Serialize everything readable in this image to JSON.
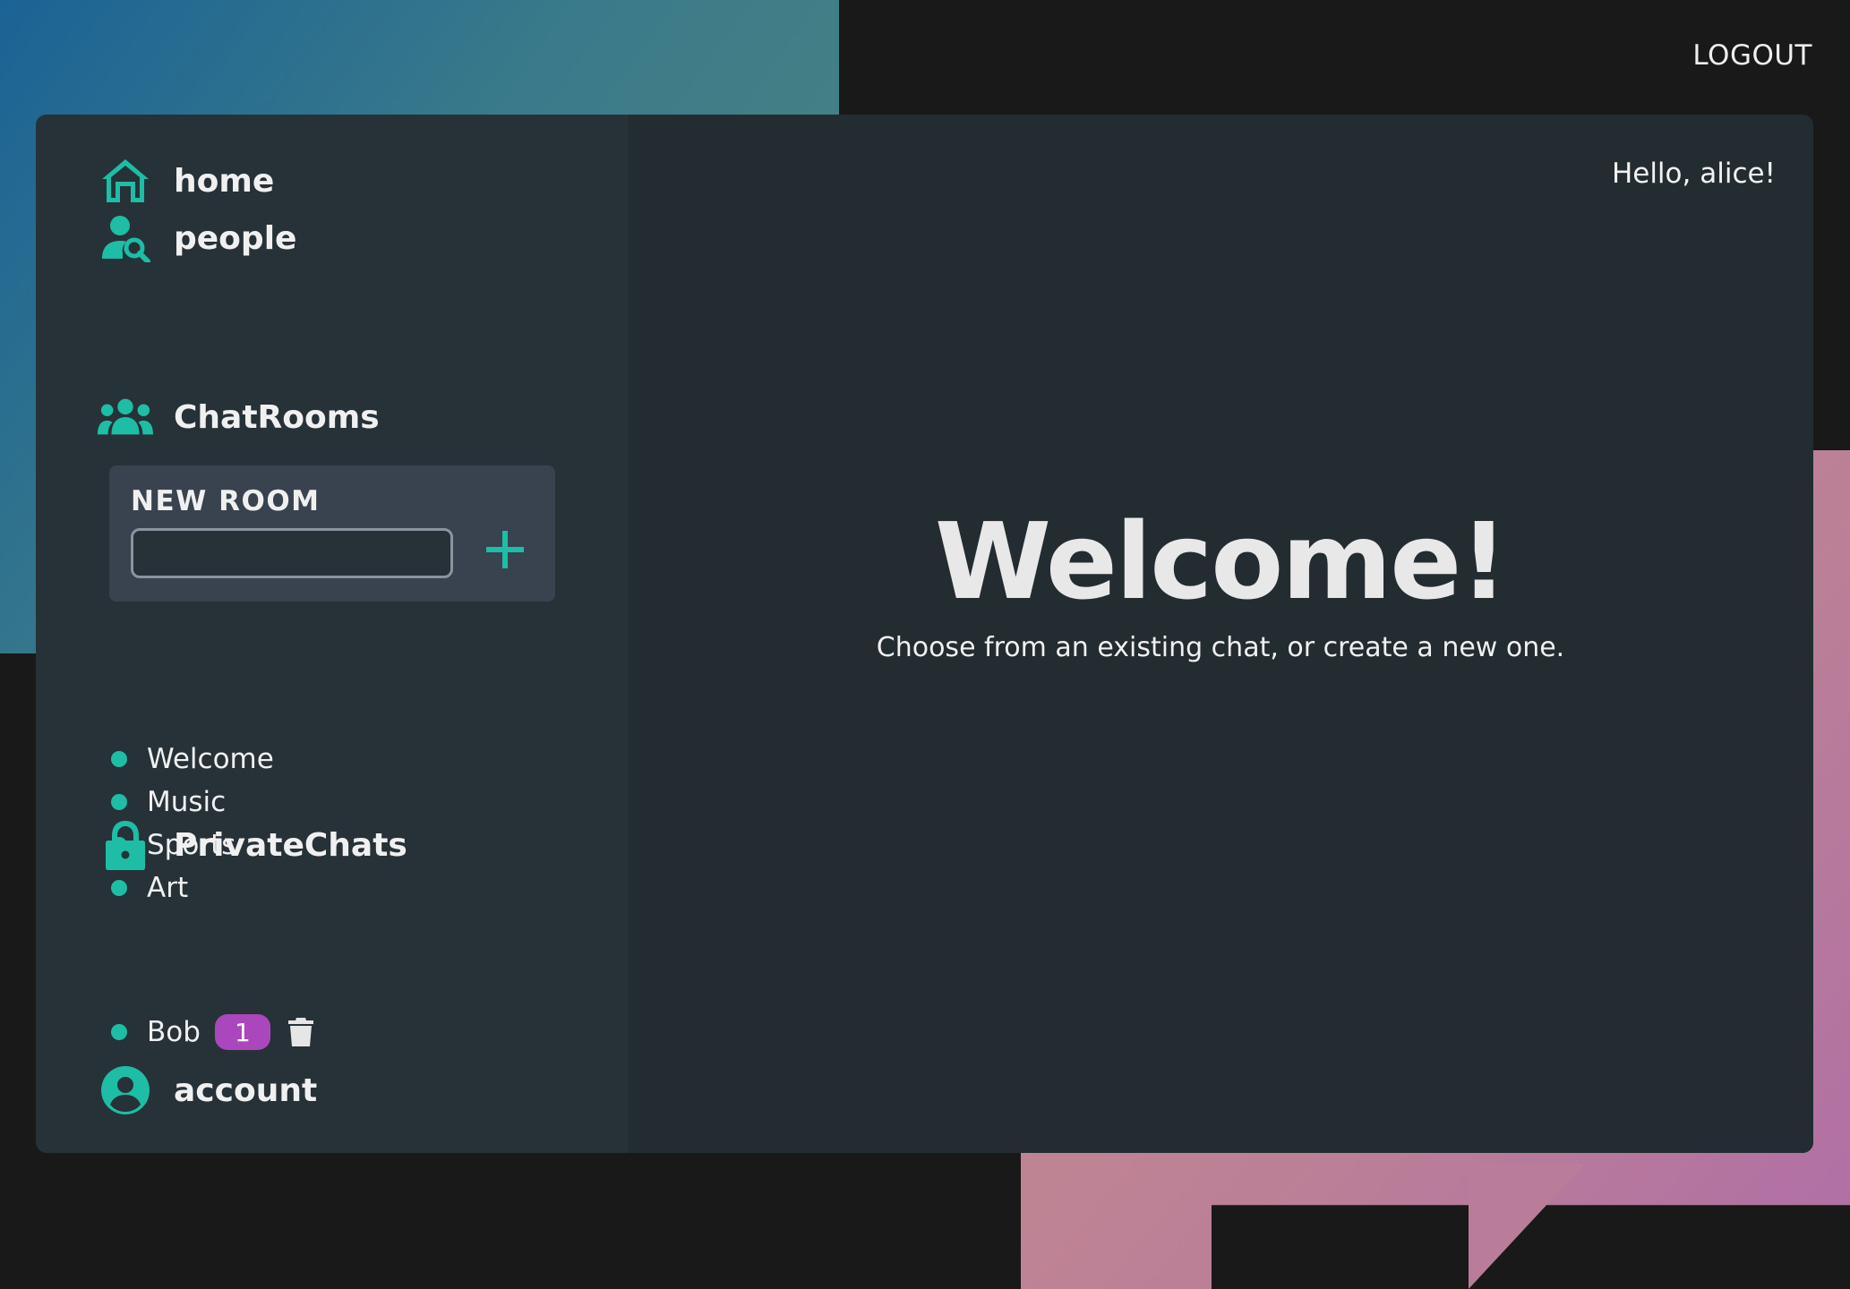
{
  "header": {
    "logout_label": "LOGOUT"
  },
  "sidebar": {
    "nav": [
      {
        "label": "home",
        "icon": "home-icon"
      },
      {
        "label": "people",
        "icon": "people-search-icon"
      }
    ],
    "chatrooms": {
      "heading": "ChatRooms",
      "icon": "group-icon",
      "new_room": {
        "title": "NEW ROOM",
        "input_value": "",
        "add_icon": "plus-icon"
      },
      "rooms": [
        "Welcome",
        "Music",
        "Sports",
        "Art"
      ]
    },
    "private_chats": {
      "heading": "PrivateChats",
      "icon": "lock-icon",
      "chats": [
        {
          "name": "Bob",
          "unread": "1",
          "delete_icon": "trash-icon"
        }
      ]
    },
    "account": {
      "label": "account",
      "icon": "account-circle-icon"
    }
  },
  "main": {
    "greeting": "Hello, alice!",
    "welcome_title": "Welcome!",
    "welcome_subtitle": "Choose from an existing chat, or create a new one."
  },
  "colors": {
    "accent": "#1dbea5",
    "badge": "#ab47bc",
    "sidebar_bg": "#263238",
    "main_bg": "#222c31",
    "page_bg": "#191919"
  }
}
